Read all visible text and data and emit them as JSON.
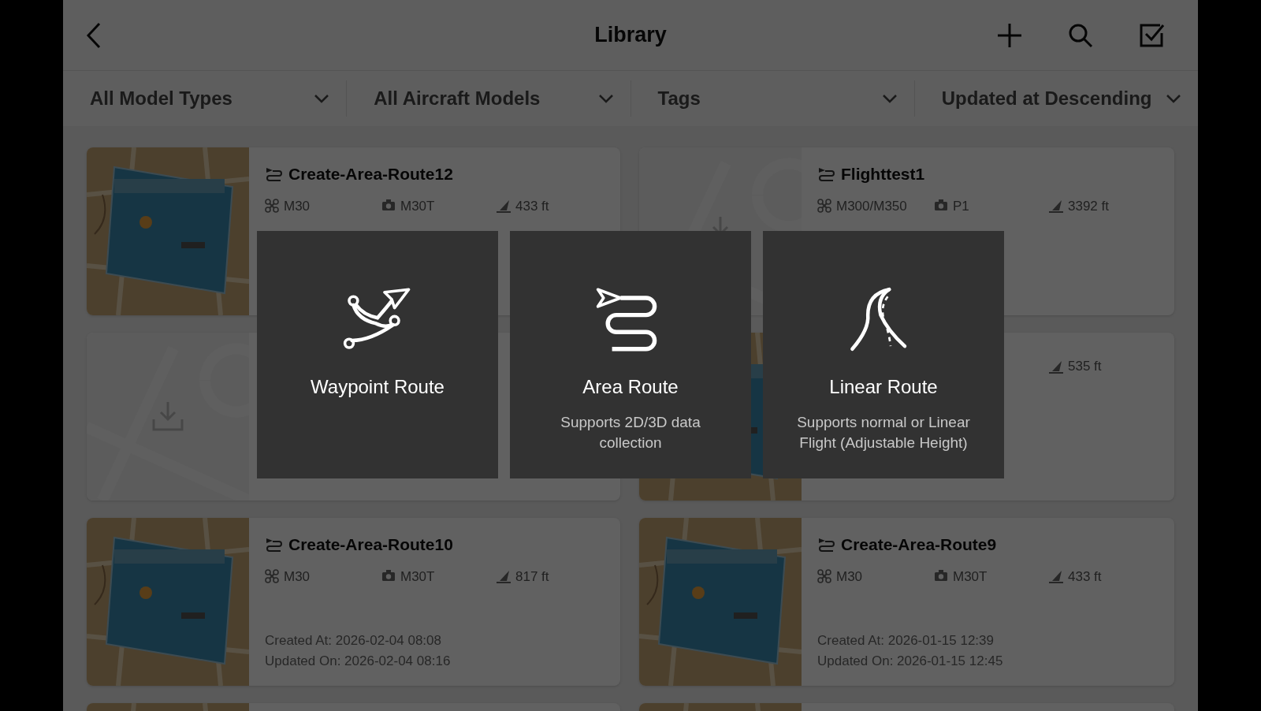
{
  "header": {
    "title": "Library"
  },
  "filters": [
    {
      "label": "All Model Types"
    },
    {
      "label": "All Aircraft Models"
    },
    {
      "label": "Tags"
    },
    {
      "label": "Updated at Descending"
    }
  ],
  "routes": [
    {
      "kind": "picture",
      "name": "Create-Area-Route12",
      "drone": "M30",
      "camera": "M30T",
      "altitude": "433 ft"
    },
    {
      "kind": "placeholder",
      "name": "Flighttest1",
      "drone": "M300/M350",
      "camera": "P1",
      "altitude": "3392 ft"
    },
    {
      "kind": "placeholder"
    },
    {
      "kind": "picture",
      "altitude": "535 ft"
    },
    {
      "kind": "picture",
      "name": "Create-Area-Route10",
      "drone": "M30",
      "camera": "M30T",
      "altitude": "817 ft",
      "created": "Created At: 2026-02-04 08:08",
      "updated": "Updated On: 2026-02-04 08:16"
    },
    {
      "kind": "picture",
      "name": "Create-Area-Route9",
      "drone": "M30",
      "camera": "M30T",
      "altitude": "433 ft",
      "created": "Created At: 2026-01-15 12:39",
      "updated": "Updated On: 2026-01-15 12:45"
    },
    {
      "kind": "picture"
    },
    {
      "kind": "picture"
    }
  ],
  "route_types": [
    {
      "kind": "waypoint",
      "title": "Waypoint Route"
    },
    {
      "kind": "area",
      "title": "Area Route",
      "description": "Supports 2D/3D data collection"
    },
    {
      "kind": "linear",
      "title": "Linear Route",
      "description": "Supports normal or Linear Flight (Adjustable Height)"
    }
  ]
}
